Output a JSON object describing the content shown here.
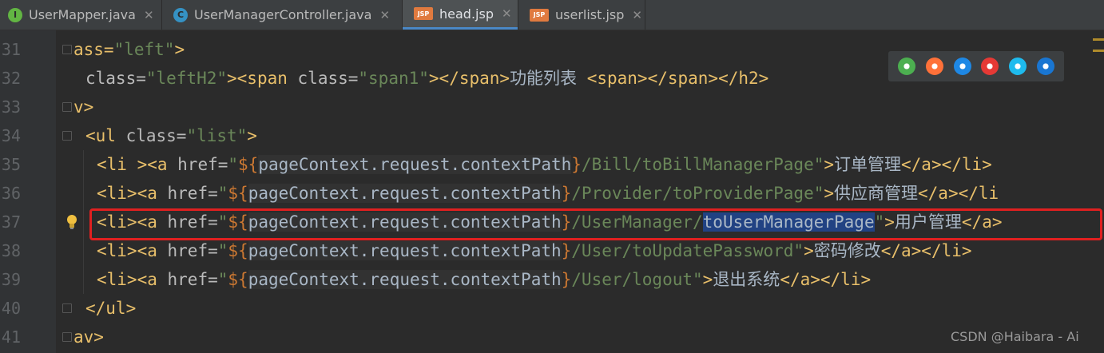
{
  "tabs": [
    {
      "label": "UserMapper.java",
      "icon": "interface-icon",
      "icon_text": "I",
      "active": false
    },
    {
      "label": "UserManagerController.java",
      "icon": "class-icon",
      "icon_text": "C",
      "active": false
    },
    {
      "label": "head.jsp",
      "icon": "jsp-file-icon",
      "icon_text": "JSP",
      "active": true
    },
    {
      "label": "userlist.jsp",
      "icon": "jsp-file-icon",
      "icon_text": "JSP",
      "active": false
    }
  ],
  "close_glyph": "✕",
  "lines": [
    {
      "num": "31",
      "parts": [
        {
          "c": "t",
          "s": "ass="
        },
        {
          "c": "v",
          "s": "\"left\""
        },
        {
          "c": "t",
          "s": ">"
        }
      ]
    },
    {
      "num": "32",
      "parts": [
        {
          "c": "a",
          "s": "class="
        },
        {
          "c": "v",
          "s": "\"leftH2\""
        },
        {
          "c": "t",
          "s": "><span "
        },
        {
          "c": "a",
          "s": "class="
        },
        {
          "c": "v",
          "s": "\"span1\""
        },
        {
          "c": "t",
          "s": "></span>"
        },
        {
          "c": "txt",
          "s": "功能列表 "
        },
        {
          "c": "t",
          "s": "<span></span></h2>"
        }
      ]
    },
    {
      "num": "33",
      "parts": [
        {
          "c": "t",
          "s": "v>"
        }
      ]
    },
    {
      "num": "34",
      "parts": [
        {
          "c": "t",
          "s": "<ul "
        },
        {
          "c": "a",
          "s": "class="
        },
        {
          "c": "v",
          "s": "\"list\""
        },
        {
          "c": "t",
          "s": ">"
        }
      ]
    },
    {
      "num": "35",
      "parts": [
        {
          "c": "t",
          "s": "<li ><a "
        },
        {
          "c": "a",
          "s": "href="
        },
        {
          "c": "v",
          "s": "\""
        },
        {
          "c": "x",
          "s": "${"
        },
        {
          "c": "el",
          "s": "pageContext.request.contextPath"
        },
        {
          "c": "x",
          "s": "}"
        },
        {
          "c": "v",
          "s": "/Bill/toBillManagerPage\""
        },
        {
          "c": "t",
          "s": ">"
        },
        {
          "c": "txt",
          "s": "订单管理"
        },
        {
          "c": "t",
          "s": "</a></li>"
        }
      ]
    },
    {
      "num": "36",
      "parts": [
        {
          "c": "t",
          "s": "<li><a "
        },
        {
          "c": "a",
          "s": "href="
        },
        {
          "c": "v",
          "s": "\""
        },
        {
          "c": "x",
          "s": "${"
        },
        {
          "c": "el",
          "s": "pageContext.request.contextPath"
        },
        {
          "c": "x",
          "s": "}"
        },
        {
          "c": "v",
          "s": "/Provider/toProviderPage\""
        },
        {
          "c": "t",
          "s": ">"
        },
        {
          "c": "txt",
          "s": "供应商管理"
        },
        {
          "c": "t",
          "s": "</a></li"
        }
      ]
    },
    {
      "num": "37",
      "parts": [
        {
          "c": "t",
          "s": "<li><a "
        },
        {
          "c": "a",
          "s": "href="
        },
        {
          "c": "v",
          "s": "\""
        },
        {
          "c": "x",
          "s": "${"
        },
        {
          "c": "el",
          "s": "pageContext.request.contextPath"
        },
        {
          "c": "x",
          "s": "}"
        },
        {
          "c": "v",
          "s": "/UserManager/"
        },
        {
          "c": "sel",
          "s": "toUserManagerPage"
        },
        {
          "c": "v",
          "s": "\""
        },
        {
          "c": "t",
          "s": ">"
        },
        {
          "c": "txt",
          "s": "用户管理"
        },
        {
          "c": "t",
          "s": "</a>"
        }
      ]
    },
    {
      "num": "38",
      "parts": [
        {
          "c": "t",
          "s": "<li><a "
        },
        {
          "c": "a",
          "s": "href="
        },
        {
          "c": "v",
          "s": "\""
        },
        {
          "c": "x",
          "s": "${"
        },
        {
          "c": "el",
          "s": "pageContext.request.contextPath"
        },
        {
          "c": "x",
          "s": "}"
        },
        {
          "c": "v",
          "s": "/User/toUpdatePassword\""
        },
        {
          "c": "t",
          "s": ">"
        },
        {
          "c": "txt",
          "s": "密码修改"
        },
        {
          "c": "t",
          "s": "</a></li>"
        }
      ]
    },
    {
      "num": "39",
      "parts": [
        {
          "c": "t",
          "s": "<li><a "
        },
        {
          "c": "a",
          "s": "href="
        },
        {
          "c": "v",
          "s": "\""
        },
        {
          "c": "x",
          "s": "${"
        },
        {
          "c": "el",
          "s": "pageContext.request.contextPath"
        },
        {
          "c": "x",
          "s": "}"
        },
        {
          "c": "v",
          "s": "/User/logout\""
        },
        {
          "c": "t",
          "s": ">"
        },
        {
          "c": "txt",
          "s": "退出系统"
        },
        {
          "c": "t",
          "s": "</a></li>"
        }
      ]
    },
    {
      "num": "40",
      "parts": [
        {
          "c": "t",
          "s": "</ul>"
        }
      ]
    },
    {
      "num": "41",
      "parts": [
        {
          "c": "t",
          "s": "av>"
        }
      ]
    }
  ],
  "browser_icons": [
    {
      "name": "chrome-icon",
      "color": "#4caf50"
    },
    {
      "name": "firefox-icon",
      "color": "#ff7139"
    },
    {
      "name": "safari-icon",
      "color": "#1e88e5"
    },
    {
      "name": "opera-icon",
      "color": "#e53935"
    },
    {
      "name": "ie-icon",
      "color": "#1ebbee"
    },
    {
      "name": "edge-icon",
      "color": "#1976d2"
    }
  ],
  "watermark": "CSDN @Haibara - Ai"
}
